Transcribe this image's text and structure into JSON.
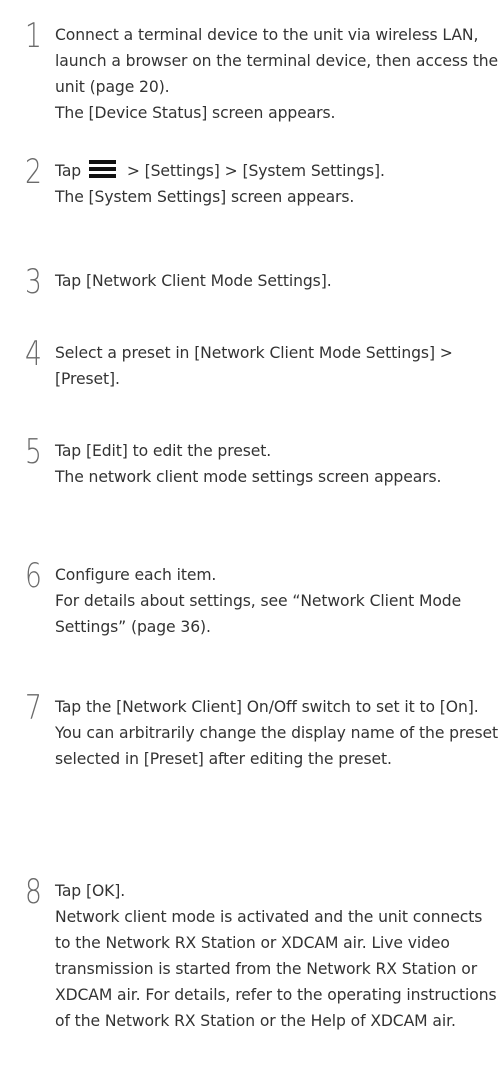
{
  "steps": [
    {
      "number": "1",
      "lines": [
        "Connect a terminal device to the unit via wireless LAN, launch a browser on the terminal device, then access the unit (page 20).",
        "The [Device Status] screen appears."
      ]
    },
    {
      "number": "2",
      "tap_prefix": "Tap",
      "icon": "menu-icon",
      "tap_rest": "> [Settings] > [System Settings].",
      "lines": [
        "The [System Settings] screen appears."
      ]
    },
    {
      "number": "3",
      "lines": [
        "Tap [Network Client Mode Settings]."
      ]
    },
    {
      "number": "4",
      "lines": [
        "Select a preset in [Network Client Mode Settings] > [Preset]."
      ]
    },
    {
      "number": "5",
      "lines": [
        "Tap [Edit] to edit the preset.",
        "The network client mode settings screen appears."
      ]
    },
    {
      "number": "6",
      "lines": [
        "Configure each item.",
        "For details about settings, see “Network Client Mode Settings” (page 36)."
      ]
    },
    {
      "number": "7",
      "lines": [
        "Tap the [Network Client] On/Off switch to set it to [On].",
        "You can arbitrarily change the display name of the preset selected in [Preset] after editing the preset."
      ]
    },
    {
      "number": "8",
      "lines": [
        "Tap [OK].",
        "Network client mode is activated and the unit connects to the Network RX Station or XDCAM air. Live video transmission is started from the Network RX Station or XDCAM air. For details, refer to the operating instructions of the Network RX Station or the Help of XDCAM air."
      ]
    }
  ]
}
